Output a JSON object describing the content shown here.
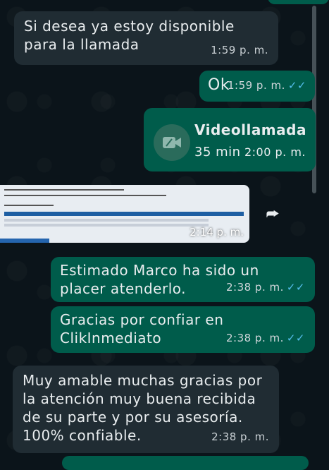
{
  "messages": [
    {
      "text": "Si desea ya estoy disponible para la llamada",
      "time": "1:59 p. m."
    },
    {
      "text": "Ok",
      "time": "1:59 p. m."
    },
    {
      "call_title": "Videollamada",
      "call_duration": "35 min",
      "time": "2:00 p. m."
    },
    {
      "image_time": "2:14 p. m."
    },
    {
      "text": "Estimado Marco ha sido un placer atenderlo.",
      "time": "2:38 p. m."
    },
    {
      "text": "Gracias por confiar en ClikInmediato",
      "time": "2:38 p. m."
    },
    {
      "text": "Muy amable muchas gracias por la atención muy buena recibida de su parte y por su asesoría. 100% confiable.",
      "time": "2:38 p. m."
    }
  ],
  "colors": {
    "background": "#0b141a",
    "incoming_bubble": "#202c33",
    "outgoing_bubble": "#005c4b",
    "read_tick": "#53bdeb"
  },
  "icons": [
    "video-camera-icon",
    "double-check-icon",
    "forward-icon"
  ]
}
